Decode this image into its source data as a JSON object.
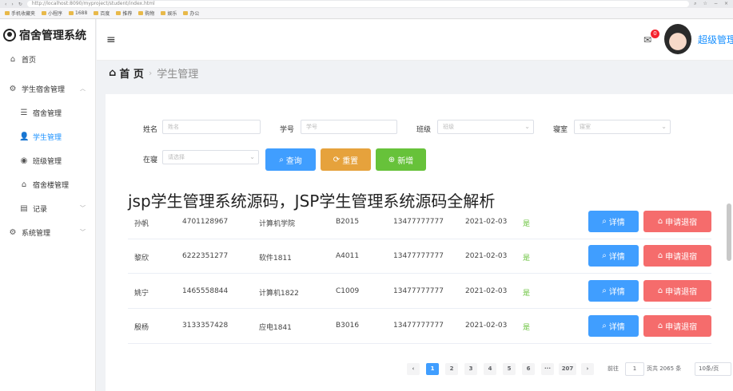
{
  "browser": {
    "url": "http://localhost:8090/myproject/student/index.html",
    "bookmarks": [
      "手机收藏夹",
      "小程序",
      "1688",
      "百度",
      "推荐",
      "购物",
      "娱乐",
      "办公"
    ]
  },
  "sidebar": {
    "title": "宿舍管理系统",
    "items": [
      {
        "label": "首页",
        "icon": "home-icon"
      },
      {
        "label": "学生宿舍管理",
        "icon": "gear-icon"
      },
      {
        "label": "宿舍管理",
        "icon": "list-icon"
      },
      {
        "label": "学生管理",
        "icon": "user-icon"
      },
      {
        "label": "班级管理",
        "icon": "class-icon"
      },
      {
        "label": "宿舍楼管理",
        "icon": "building-icon"
      },
      {
        "label": "记录",
        "icon": "document-icon"
      },
      {
        "label": "系统管理",
        "icon": "settings-icon"
      }
    ]
  },
  "header": {
    "badge": "0",
    "admin": "超级管理"
  },
  "breadcrumb": {
    "home": "首 页",
    "current": "学生管理"
  },
  "filters": {
    "name_label": "姓名",
    "name_placeholder": "姓名",
    "sno_label": "学号",
    "sno_placeholder": "学号",
    "class_label": "班级",
    "class_placeholder": "班级",
    "room_label": "寝室",
    "room_placeholder": "寝室",
    "status_label": "在寝",
    "status_placeholder": "请选择",
    "query": "查询",
    "reset": "重置",
    "add": "新增"
  },
  "overlay_title": "jsp学生管理系统源码，JSP学生管理系统源码全解析",
  "rows": [
    {
      "name": "孙帆",
      "sno": "4701128967",
      "cls": "计算机学院",
      "room": "B2015",
      "phone": "13477777777",
      "date": "2021-02-03",
      "status": "是"
    },
    {
      "name": "黎欣",
      "sno": "6222351277",
      "cls": "软件1811",
      "room": "A4011",
      "phone": "13477777777",
      "date": "2021-02-03",
      "status": "是"
    },
    {
      "name": "姚宁",
      "sno": "1465558844",
      "cls": "计算机1822",
      "room": "C1009",
      "phone": "13477777777",
      "date": "2021-02-03",
      "status": "是"
    },
    {
      "name": "殷杨",
      "sno": "3133357428",
      "cls": "应电1841",
      "room": "B3016",
      "phone": "13477777777",
      "date": "2021-02-03",
      "status": "是"
    }
  ],
  "row_actions": {
    "detail": "详情",
    "checkout": "申请退宿"
  },
  "pagination": {
    "pages": [
      "1",
      "2",
      "3",
      "4",
      "5",
      "6",
      "···",
      "207"
    ],
    "goto": "前往",
    "current": "1",
    "total": "页共 2065 条",
    "size": "10条/页"
  }
}
